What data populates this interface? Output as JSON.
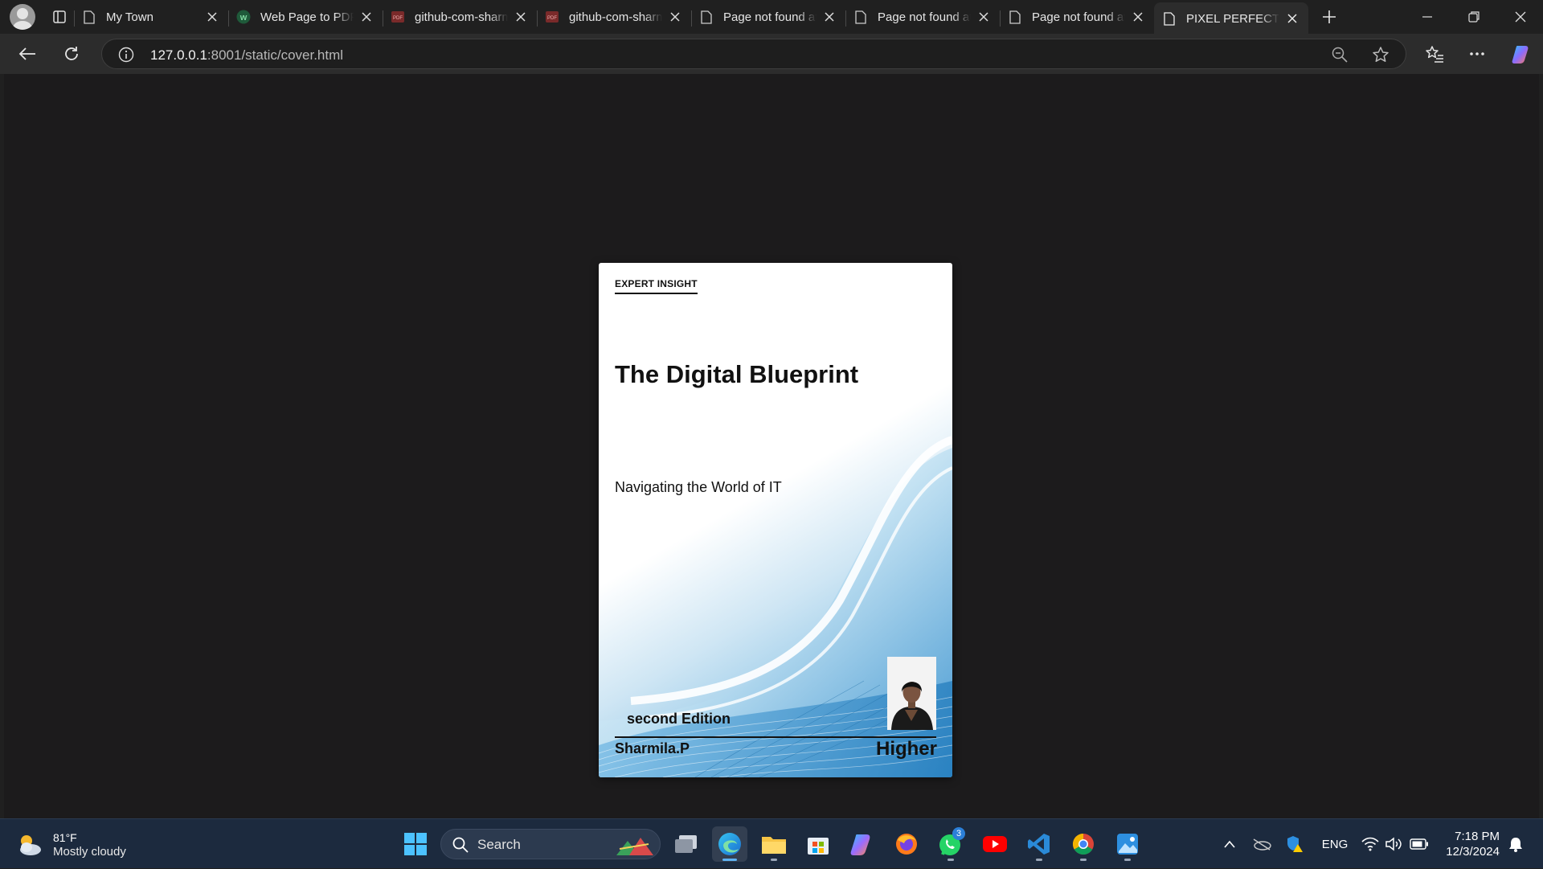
{
  "browser": {
    "tabs": [
      {
        "title": "My Town",
        "icon": "page-icon",
        "active": false
      },
      {
        "title": "Web Page to PDF",
        "icon": "w-logo-icon",
        "active": false
      },
      {
        "title": "github-com-sharmila",
        "icon": "pdf-icon",
        "active": false
      },
      {
        "title": "github-com-sharmila",
        "icon": "pdf-icon",
        "active": false
      },
      {
        "title": "Page not found at",
        "icon": "page-icon",
        "active": false
      },
      {
        "title": "Page not found at",
        "icon": "page-icon",
        "active": false
      },
      {
        "title": "Page not found at",
        "icon": "page-icon",
        "active": false
      },
      {
        "title": "PIXEL PERFECT: Book",
        "icon": "page-icon",
        "active": true
      }
    ],
    "address": {
      "host": "127.0.0.1",
      "rest": ":8001/static/cover.html"
    }
  },
  "cover": {
    "badge": "EXPERT INSIGHT",
    "title": "The Digital Blueprint",
    "subtitle": "Navigating the World of IT",
    "edition": "second Edition",
    "author": "Sharmila.P",
    "publisher": "Higher"
  },
  "taskbar": {
    "weather": {
      "temp": "81°F",
      "condition": "Mostly cloudy"
    },
    "search_label": "Search",
    "whatsapp_badge": "3",
    "language": "ENG",
    "time": "7:18 PM",
    "date": "12/3/2024"
  },
  "colors": {
    "accent": "#5fb2f2",
    "taskbar": "#1c2a3e",
    "viewport": "#1c1b1c"
  }
}
